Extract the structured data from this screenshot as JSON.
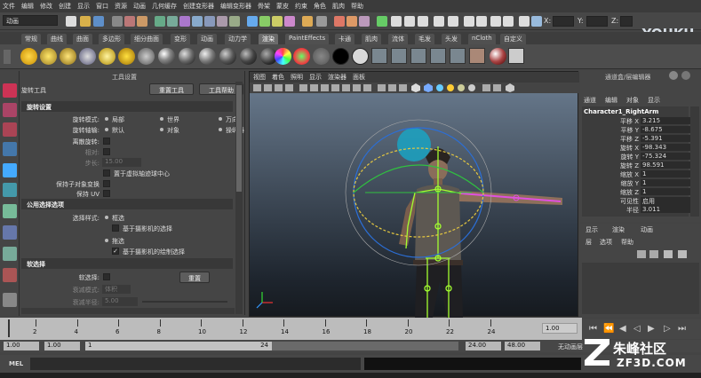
{
  "menubar": {
    "items": [
      "文件",
      "编辑",
      "修改",
      "创建",
      "显示",
      "窗口",
      "资源",
      "动画",
      "几何缓存",
      "创建变形器",
      "编辑变形器",
      "骨架",
      "蒙皮",
      "约束",
      "角色",
      "肌肉",
      "帮助"
    ]
  },
  "statusline": {
    "mode": "动画",
    "x_label": "X:",
    "y_label": "Y:",
    "z_label": "Z:"
  },
  "shelf": {
    "tabs": [
      "常规",
      "曲线",
      "曲面",
      "多边形",
      "细分曲面",
      "变形",
      "动画",
      "动力学",
      "渲染",
      "PaintEffects",
      "卡通",
      "肌肉",
      "流体",
      "毛发",
      "头发",
      "nCloth",
      "自定义"
    ],
    "active": "渲染"
  },
  "watermark": {
    "logo": "YOUKU",
    "cn": "优酷",
    "brand": "朱峰社区",
    "url": "ZF3D.COM"
  },
  "toolpanel": {
    "header": "工具设置",
    "tool_name": "旋转工具",
    "reset_button": "重置工具",
    "help_button": "工具帮助",
    "sec_rotate": "旋转设置",
    "rot_mode_label": "旋转模式:",
    "rot_mode_opts": [
      "局部",
      "世界",
      "万向"
    ],
    "rot_axis_label": "旋转轴输:",
    "rot_axis_opts": [
      "默认",
      "对象",
      "操纵器"
    ],
    "discrete_label": "离散旋转:",
    "relative_label": "相对:",
    "step_label": "步长:",
    "step_value": "15.00",
    "virtual_pivot": "置于虚拟轴迹球中心",
    "preserve_label": "保持子对象变换",
    "preserve_uv": "保持 UV",
    "sec_common": "公用选择选项",
    "sel_style_label": "选择样式:",
    "sel_style_opt1": "框选",
    "sel_cam": "基于摄影机的选择",
    "sel_style_opt2": "拖选",
    "sel_cam_paint": "基于摄影机的绘制选择",
    "sec_soft": "软选择",
    "soft_label": "软选择:",
    "soft_reset": "重置",
    "falloff_mode_label": "衰减模式:",
    "falloff_mode": "体积",
    "falloff_radius_label": "衰减半径:",
    "falloff_radius": "5.00"
  },
  "viewport": {
    "menus": [
      "视图",
      "着色",
      "照明",
      "显示",
      "渲染器",
      "面板"
    ]
  },
  "channel": {
    "header": "通道盒/层编辑器",
    "tabs": [
      "通道",
      "编辑",
      "对象",
      "显示"
    ],
    "object": "Character1_RightArm",
    "rows": [
      {
        "name": "平移 X",
        "value": "3.215"
      },
      {
        "name": "平移 Y",
        "value": "-8.675"
      },
      {
        "name": "平移 Z",
        "value": "-5.391"
      },
      {
        "name": "旋转 X",
        "value": "-98.343"
      },
      {
        "name": "旋转 Y",
        "value": "-75.324"
      },
      {
        "name": "旋转 Z",
        "value": "98.591"
      },
      {
        "name": "缩放 X",
        "value": "1"
      },
      {
        "name": "缩放 Y",
        "value": "1"
      },
      {
        "name": "缩放 Z",
        "value": "1"
      },
      {
        "name": "可见性",
        "value": "启用"
      },
      {
        "name": "半径",
        "value": "3.011"
      }
    ]
  },
  "layer": {
    "tabs": [
      "显示",
      "渲染",
      "动画"
    ],
    "menus": [
      "层",
      "选项",
      "帮助"
    ]
  },
  "timeline": {
    "ticks": [
      "2",
      "4",
      "6",
      "8",
      "10",
      "12",
      "14",
      "16",
      "18",
      "20",
      "22",
      "24"
    ],
    "current": "1.00"
  },
  "range": {
    "start1": "1.00",
    "start2": "1.00",
    "marker": "1",
    "end_marker": "24",
    "end1": "24.00",
    "end2": "48.00",
    "anim_layer": "无动画层"
  },
  "mel": {
    "label": "MEL"
  }
}
